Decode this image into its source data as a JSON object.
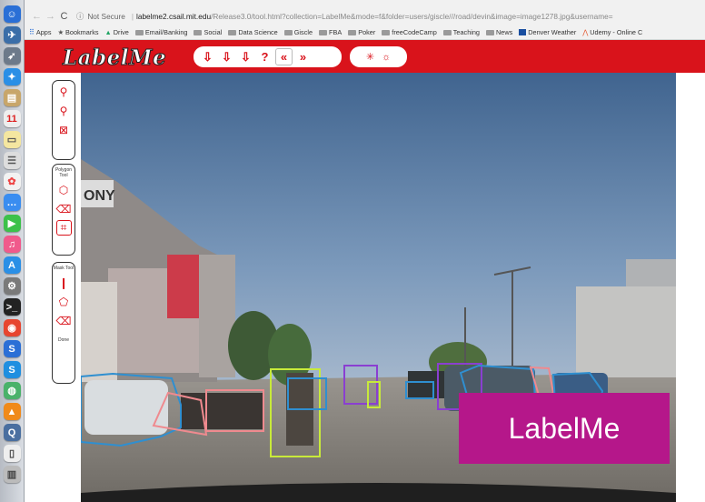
{
  "browser": {
    "secure_label": "Not Secure",
    "url_host": "labelme2.csail.mit.edu",
    "url_path": "/Release3.0/tool.html?collection=LabelMe&mode=f&folder=users/giscle///road/devin&image=image1278.jpg&username=",
    "bookmarks": [
      "Apps",
      "Bookmarks",
      "Drive",
      "Email/Banking",
      "Social",
      "Data Science",
      "Giscle",
      "FBA",
      "Poker",
      "freeCodeCamp",
      "Teaching",
      "News",
      "Denver Weather",
      "Udemy - Online C"
    ]
  },
  "app": {
    "logo": "LabelMe"
  },
  "tools": {
    "polygon_caption": "Polygon Tool",
    "mask_caption": "Mask Tool",
    "done_label": "Done"
  },
  "watermark": "LabelMe",
  "image_labels": {
    "store_sign": "ONY"
  },
  "colors": {
    "header_red": "#d9131b",
    "watermark_bg": "#b5178a",
    "box_blue": "#2f8fd0",
    "box_pink": "#ef8a8f",
    "box_yellow": "#c8ea3a",
    "box_purple": "#8a3fd1"
  }
}
